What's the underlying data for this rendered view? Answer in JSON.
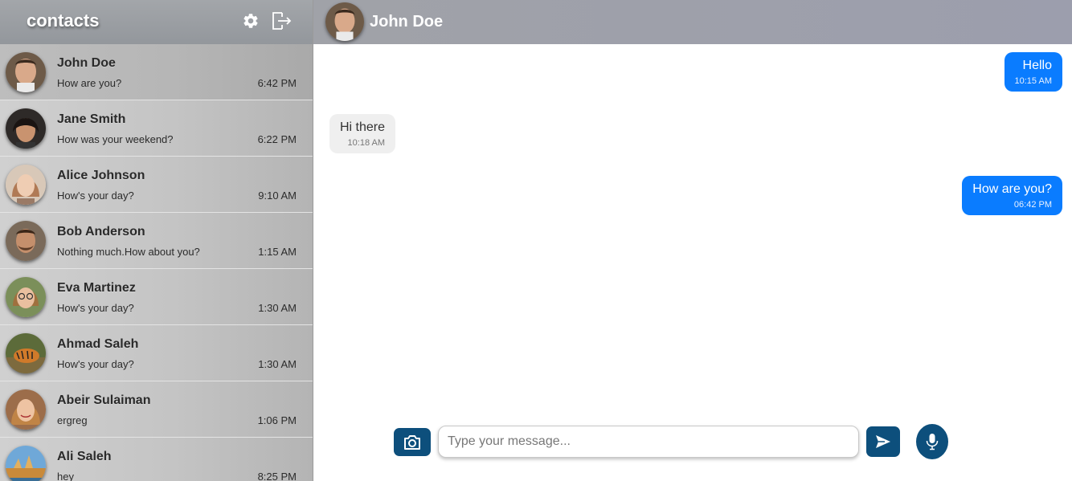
{
  "sidebar": {
    "title": "contacts",
    "icons": {
      "settings": "gear-icon",
      "logout": "logout-icon"
    },
    "contacts": [
      {
        "name": "John Doe",
        "preview": "How are you?",
        "time": "6:42 PM",
        "avatar": "man-short-hair"
      },
      {
        "name": "Jane Smith",
        "preview": "How was your weekend?",
        "time": "6:22 PM",
        "avatar": "woman-dark-hair"
      },
      {
        "name": "Alice Johnson",
        "preview": "How's your day?",
        "time": "9:10 AM",
        "avatar": "woman-light-hair"
      },
      {
        "name": "Bob Anderson",
        "preview": "Nothing much.How about you?",
        "time": "1:15 AM",
        "avatar": "man-beard"
      },
      {
        "name": "Eva Martinez",
        "preview": "How's your day?",
        "time": "1:30 AM",
        "avatar": "woman-glasses"
      },
      {
        "name": "Ahmad Saleh",
        "preview": "How's your day?",
        "time": "1:30 AM",
        "avatar": "tiger-photo"
      },
      {
        "name": "Abeir Sulaiman",
        "preview": "ergreg",
        "time": "1:06 PM",
        "avatar": "woman-smiling"
      },
      {
        "name": "Ali Saleh",
        "preview": "hey",
        "time": "8:25 PM",
        "avatar": "landscape-photo"
      }
    ]
  },
  "chat": {
    "contact_name": "John Doe",
    "messages": [
      {
        "direction": "out",
        "text": "Hello",
        "time": "10:15 AM"
      },
      {
        "direction": "in",
        "text": "Hi there",
        "time": "10:18 AM"
      },
      {
        "direction": "out",
        "text": "How are you?",
        "time": "06:42 PM"
      }
    ]
  },
  "composer": {
    "placeholder": "Type your message...",
    "value": "",
    "icons": {
      "camera": "camera-icon",
      "send": "send-icon",
      "mic": "microphone-icon"
    }
  },
  "colors": {
    "accent_button": "#0d4f7c",
    "outgoing_bubble": "#0a7cff",
    "incoming_bubble": "#efefef"
  }
}
